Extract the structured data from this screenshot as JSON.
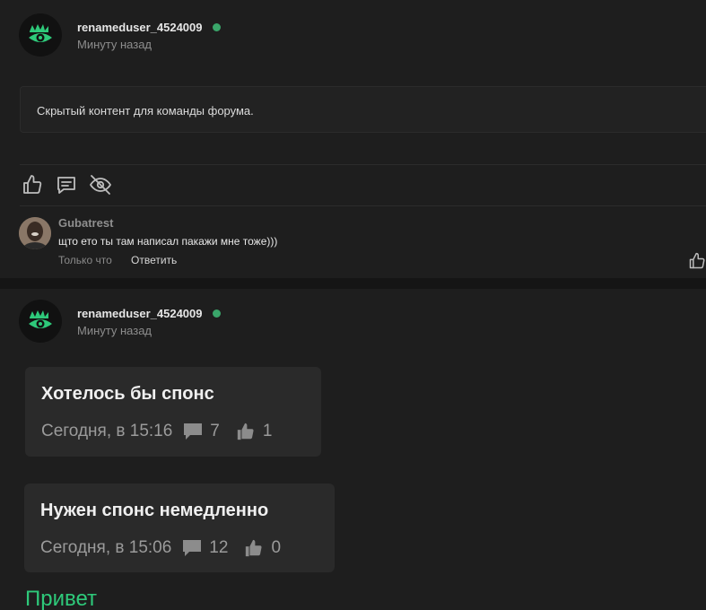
{
  "post1": {
    "author": "renameduser_4524009",
    "time": "Минуту назад",
    "hidden_text": "Скрытый контент для команды форума.",
    "comment": {
      "author": "Gubatrest",
      "text": "щто ето ты там написал пакажи мне тоже)))",
      "time": "Только что",
      "reply_label": "Ответить"
    }
  },
  "post2": {
    "author": "renameduser_4524009",
    "time": "Минуту назад",
    "threads": [
      {
        "title": "Хотелось бы спонс",
        "time": "Сегодня, в 15:16",
        "replies": "7",
        "likes": "1"
      },
      {
        "title": "Нужен спонс немедленно",
        "time": "Сегодня, в 15:06",
        "replies": "12",
        "likes": "0"
      }
    ],
    "greeting": "Привет"
  },
  "colors": {
    "online": "#3aa66a",
    "accent_green": "#2ec97a"
  },
  "icons": [
    "eye-logo-icon",
    "like-icon",
    "comment-icon",
    "hide-icon",
    "speech-bubble-icon"
  ]
}
